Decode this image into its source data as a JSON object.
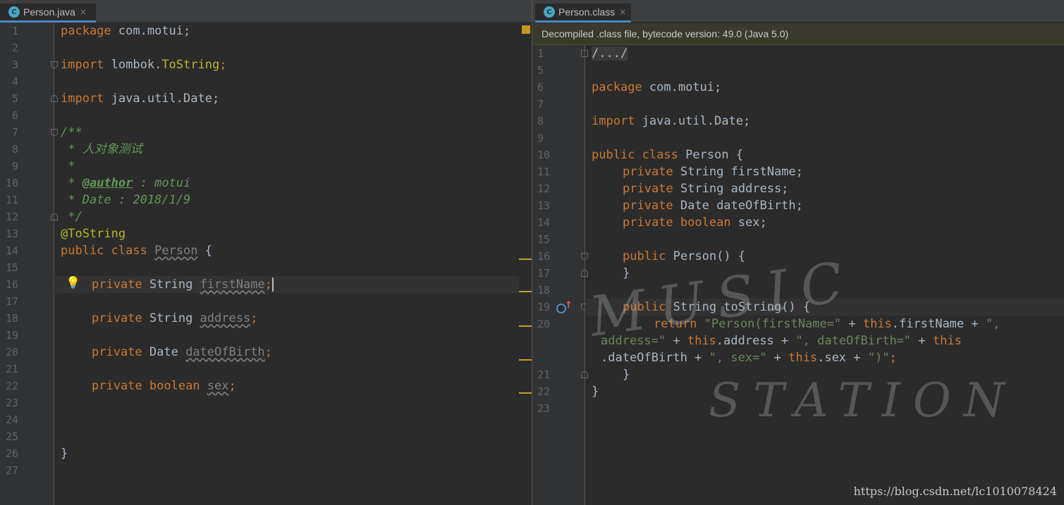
{
  "left_tab": {
    "icon_letter": "C",
    "label": "Person.java",
    "close": "×"
  },
  "right_tab": {
    "icon_letter": "C",
    "label": "Person.class",
    "close": "×"
  },
  "banner": {
    "text": "Decompiled .class file, bytecode version: 49.0 (Java 5.0)"
  },
  "left_code": {
    "line_numbers": [
      "1",
      "2",
      "3",
      "4",
      "5",
      "6",
      "7",
      "8",
      "9",
      "10",
      "11",
      "12",
      "13",
      "14",
      "15",
      "16",
      "17",
      "18",
      "19",
      "20",
      "21",
      "22",
      "23",
      "24",
      "25",
      "26",
      "27"
    ],
    "l1_kw": "package",
    "l1_rest": " com.motui;",
    "l3_kw": "import",
    "l3_pkg": " lombok.",
    "l3_cls": "ToString",
    "l3_end": ";",
    "l5_kw": "import",
    "l5_rest": " java.util.Date;",
    "l7": "/**",
    "l8": " * 人对象测试",
    "l9": " *",
    "l10_a": " * ",
    "l10_tag": "@author",
    "l10_b": " : motui",
    "l11": " * Date : 2018/1/9",
    "l12": " */",
    "l13": "@ToString",
    "l14_kw": "public class ",
    "l14_name": "Person",
    "l14_end": " {",
    "l16_kw": "private ",
    "l16_type": "String ",
    "l16_name": "firstName",
    "l16_end": ";",
    "l18_kw": "private ",
    "l18_type": "String ",
    "l18_name": "address",
    "l18_end": ";",
    "l20_kw": "private ",
    "l20_type": "Date ",
    "l20_name": "dateOfBirth",
    "l20_end": ";",
    "l22_kw": "private ",
    "l22_type": "boolean ",
    "l22_name": "sex",
    "l22_end": ";",
    "l26": "}"
  },
  "right_code": {
    "line_numbers": [
      "1",
      "5",
      "6",
      "7",
      "8",
      "9",
      "10",
      "11",
      "12",
      "13",
      "14",
      "15",
      "16",
      "17",
      "18",
      "19",
      "20",
      "21",
      "22",
      "23"
    ],
    "l1": "/.../",
    "l6_kw": "package",
    "l6_rest": " com.motui;",
    "l8_kw": "import",
    "l8_rest": " java.util.Date;",
    "l10_kw": "public class",
    "l10_rest": " Person {",
    "l11_kw": "private",
    "l11_rest": " String firstName;",
    "l12_kw": "private",
    "l12_rest": " String address;",
    "l13_kw": "private",
    "l13_rest": " Date dateOfBirth;",
    "l14_kw": "private",
    "l14_type": " boolean",
    "l14_rest": " sex;",
    "l16_kw": "public",
    "l16_rest": " Person() {",
    "l17": "}",
    "l19_kw": "public",
    "l19_rest": " String toString() {",
    "l20_kw": "return",
    "l20_s1": " \"Person(firstName=\"",
    "l20_p1": " + ",
    "l20_this1": "this",
    "l20_r1": ".firstName + ",
    "l20_s2": "\",",
    "l20b_s": "address=\"",
    "l20b_p": " + ",
    "l20b_this": "this",
    "l20b_r": ".address + ",
    "l20b_s2": "\", dateOfBirth=\"",
    "l20b_p2": " + ",
    "l20b_this2": "this",
    "l20c_r": ".dateOfBirth + ",
    "l20c_s": "\", sex=\"",
    "l20c_p": " + ",
    "l20c_this": "this",
    "l20c_r2": ".sex + ",
    "l20c_s2": "\")\"",
    "l20c_end": ";",
    "l21": "}",
    "l22": "}"
  },
  "watermark": {
    "line1": "MUSIC",
    "line2": "STATION"
  },
  "credit": "https://blog.csdn.net/lc1010078424"
}
